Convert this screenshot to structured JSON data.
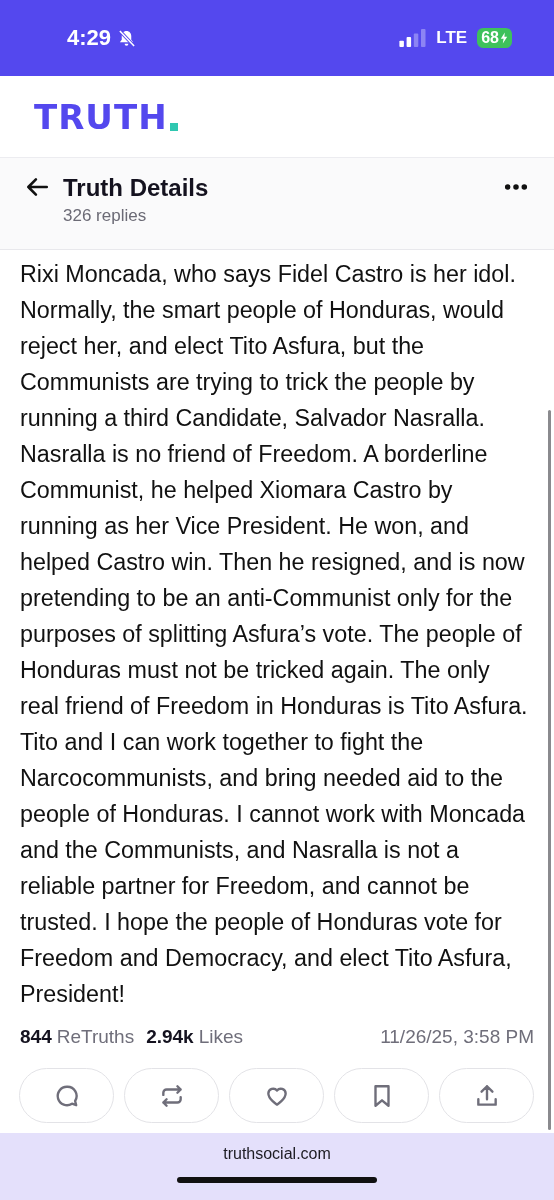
{
  "status_bar": {
    "time": "4:29",
    "network": "LTE",
    "battery": "68"
  },
  "app_header": {
    "logo": "TRUTH"
  },
  "nav": {
    "title": "Truth Details",
    "subtitle": "326 replies"
  },
  "post": {
    "text": "Rixi Moncada, who says Fidel Castro is her idol. Normally, the smart people of Honduras, would reject her, and elect Tito Asfura, but the Communists are trying to trick the people by running a third Candidate, Salvador Nasralla. Nasralla is no friend of Freedom. A borderline Communist, he helped Xiomara Castro by running as her Vice President. He won, and helped Castro win. Then he resigned, and is now pretending to be an anti-Communist only for the purposes of splitting Asfura’s vote. The people of Honduras must not be tricked again. The only real friend of Freedom in Honduras is Tito Asfura. Tito and I can work together to fight the Narcocommunists, and bring needed aid to the people of Honduras. I cannot work with Moncada and the Communists, and Nasralla is not a reliable partner for Freedom, and cannot be trusted. I hope the people of Honduras vote for Freedom and Democracy, and elect Tito Asfura, President!",
    "stats": [
      {
        "count": "844",
        "label": "ReTruths"
      },
      {
        "count": "2.94k",
        "label": "Likes"
      }
    ],
    "timestamp": "11/26/25, 3:58 PM",
    "actions": [
      {
        "kind": "reply"
      },
      {
        "kind": "retruth"
      },
      {
        "kind": "like"
      },
      {
        "kind": "bookmark"
      },
      {
        "kind": "share"
      }
    ]
  },
  "browser_bar": {
    "url": "truthsocial.com"
  }
}
